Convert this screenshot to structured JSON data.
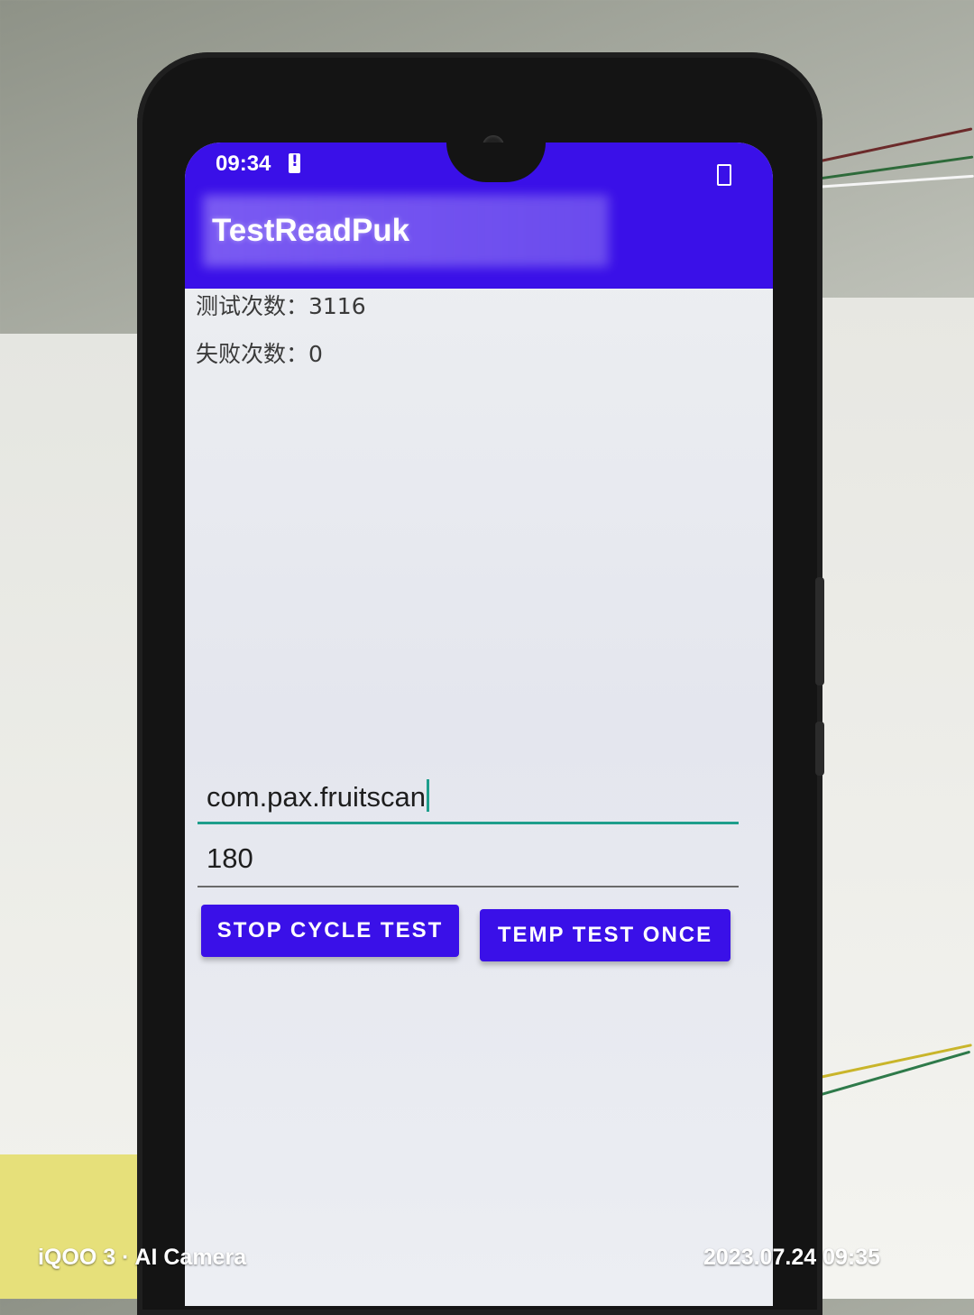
{
  "status_bar": {
    "time": "09:34"
  },
  "app_bar": {
    "title": "TestReadPuk"
  },
  "stats": {
    "test_count": "测试次数：3116",
    "fail_count": "失败次数：0"
  },
  "inputs": {
    "package_name": "com.pax.fruitscan",
    "interval": "180"
  },
  "buttons": {
    "stop_cycle": "STOP CYCLE TEST",
    "temp_once": "TEMP TEST ONCE"
  },
  "watermark": {
    "left": "iQOO 3 · AI Camera",
    "right": "2023.07.24 09:35"
  },
  "colors": {
    "primary": "#3a10e8",
    "accent": "#1e9e8c"
  }
}
